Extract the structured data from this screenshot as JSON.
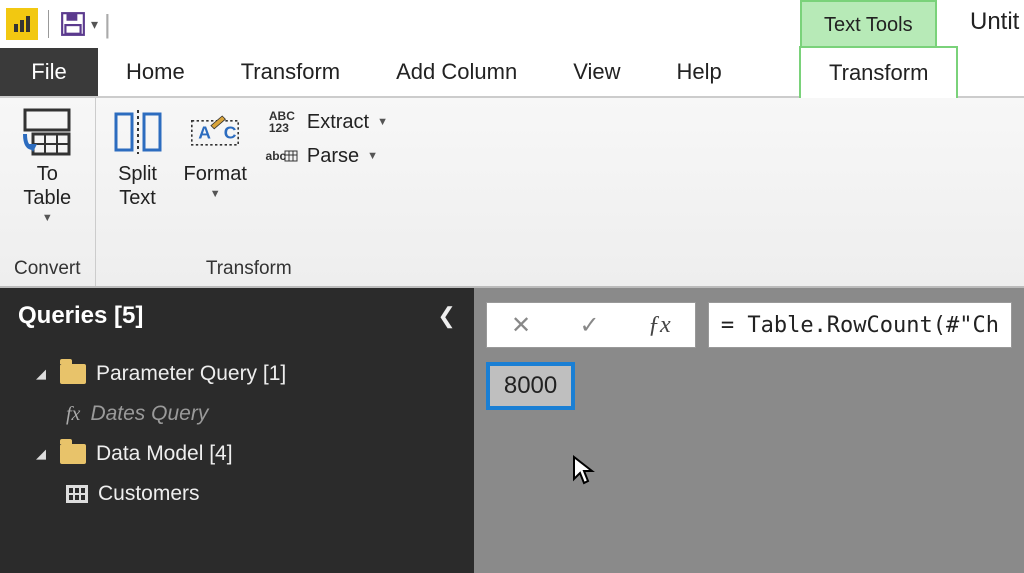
{
  "titlebar": {
    "tools_tab": "Text Tools",
    "window_title": "Untit"
  },
  "tabs": {
    "file": "File",
    "home": "Home",
    "transform": "Transform",
    "add_column": "Add Column",
    "view": "View",
    "help": "Help",
    "context_transform": "Transform"
  },
  "ribbon": {
    "convert": {
      "group": "Convert",
      "to_table": "To\nTable"
    },
    "transform": {
      "group": "Transform",
      "split_text": "Split\nText",
      "format": "Format",
      "extract": "Extract",
      "parse": "Parse"
    }
  },
  "queries": {
    "title": "Queries [5]",
    "nodes": {
      "param_group": "Parameter Query [1]",
      "dates_query": "Dates Query",
      "data_model": "Data Model [4]",
      "customers": "Customers"
    }
  },
  "preview": {
    "formula": "= Table.RowCount(#\"Ch",
    "result": "8000"
  },
  "icons": {
    "extract_prefix": "ABC\n123",
    "parse_prefix": "abc"
  }
}
